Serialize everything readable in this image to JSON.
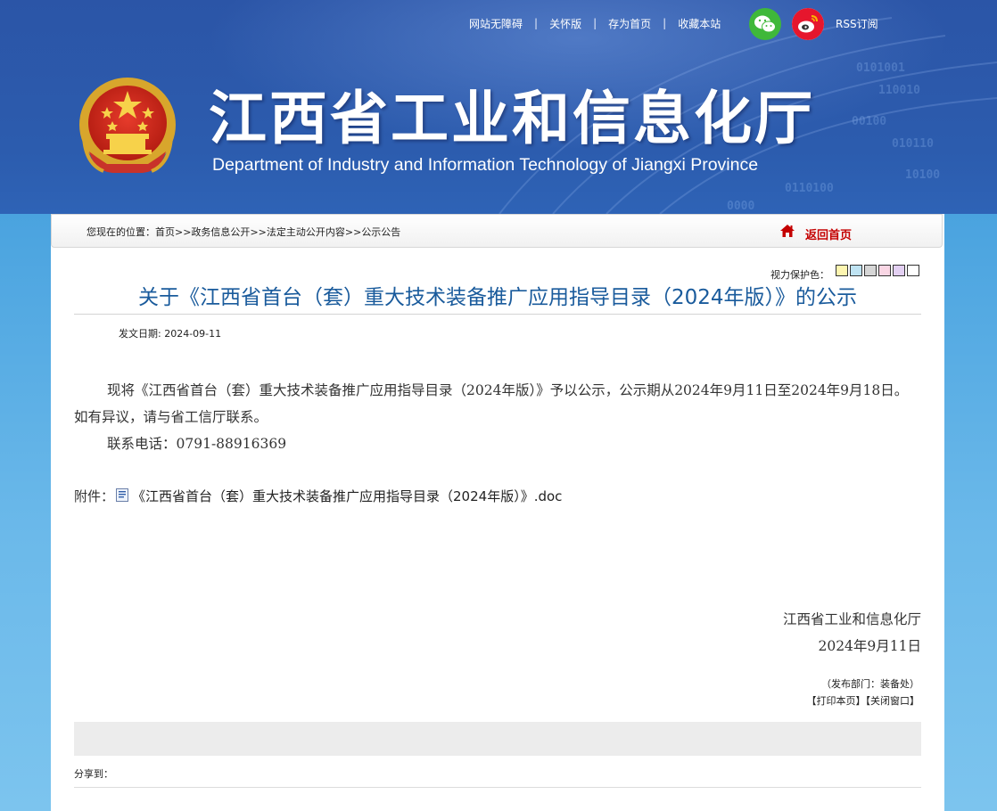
{
  "header": {
    "top_links": [
      "网站无障碍",
      "关怀版",
      "存为首页",
      "收藏本站"
    ],
    "separator": "|",
    "rss_label": "RSS订阅",
    "title": "江西省工业和信息化厅",
    "subtitle": "Department of Industry and Information Technology of Jiangxi Province",
    "icons": [
      "national-emblem-icon",
      "wechat-icon",
      "weibo-icon"
    ]
  },
  "breadcrumb": {
    "prefix": "您现在的位置：",
    "items": [
      "首页",
      "政务信息公开",
      "法定主动公开内容",
      "公示公告"
    ],
    "separator": ">>",
    "home_label": "返回首页"
  },
  "eye_protection": {
    "label": "视力保护色：",
    "colors": [
      "#fdf5b0",
      "#bfe3f2",
      "#d6d6d6",
      "#f9d6e4",
      "#e3d0f2",
      "#ffffff"
    ]
  },
  "article": {
    "title": "关于《江西省首台（套）重大技术装备推广应用指导目录（2024年版）》的公示",
    "date_label": "发文日期: 2024-09-11",
    "paragraphs": [
      "现将《江西省首台（套）重大技术装备推广应用指导目录（2024年版）》予以公示，公示期从2024年9月11日至2024年9月18日。如有异议，请与省工信厅联系。",
      "联系电话：0791-88916369"
    ],
    "attachment_label": "附件：",
    "attachment_name": "《江西省首台（套）重大技术装备推广应用指导目录（2024年版）》.doc",
    "signature_org": "江西省工业和信息化厅",
    "signature_date": "2024年9月11日",
    "department": "（发布部门：装备处）",
    "print_label": "【打印本页】",
    "close_label": "【关闭窗口】"
  },
  "share_label": "分享到：",
  "colors": {
    "header_blue": "#2b55a7",
    "title_blue": "#1a5b9c",
    "home_red": "#c40000",
    "wechat_green": "#3fb83a",
    "weibo_red": "#e6162d"
  }
}
